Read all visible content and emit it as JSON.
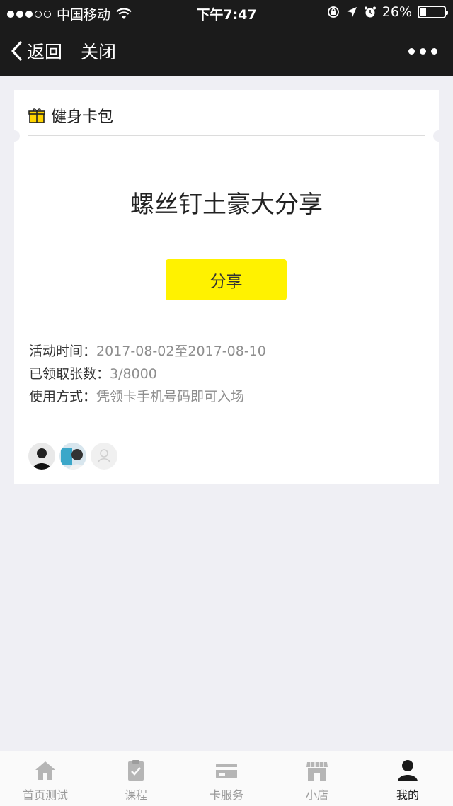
{
  "status_bar": {
    "carrier": "中国移动",
    "time": "下午7:47",
    "battery": "26%",
    "battery_level": 0.26
  },
  "nav": {
    "back_label": "返回",
    "close_label": "关闭"
  },
  "card": {
    "header_title": "健身卡包",
    "title": "螺丝钉土豪大分享",
    "share_label": "分享",
    "info": {
      "activity_label": "活动时间：",
      "activity_value": "2017-08-02至2017-08-10",
      "claimed_label": "已领取张数：",
      "claimed_value": "3/8000",
      "usage_label": "使用方式：",
      "usage_value": "凭领卡手机号码即可入场"
    },
    "accent_color": "#fff200"
  },
  "tabs": [
    {
      "label": "首页测试",
      "icon": "home-icon"
    },
    {
      "label": "课程",
      "icon": "clipboard-check-icon"
    },
    {
      "label": "卡服务",
      "icon": "card-icon"
    },
    {
      "label": "小店",
      "icon": "shop-icon"
    },
    {
      "label": "我的",
      "icon": "user-icon",
      "active": true
    }
  ]
}
